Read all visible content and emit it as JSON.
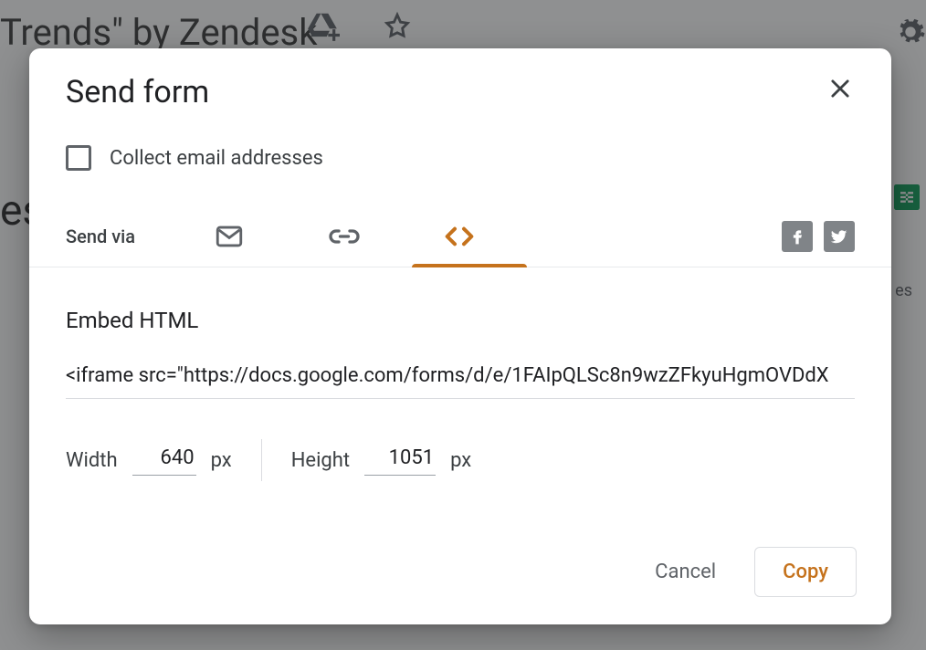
{
  "background": {
    "page_title_fragment": "Trends\" by Zendesk",
    "label_left_fragment": "es",
    "label_right_fragment": "es"
  },
  "dialog": {
    "title": "Send form",
    "collect_label": "Collect email addresses",
    "send_via_label": "Send via",
    "tabs": {
      "email": "email-tab",
      "link": "link-tab",
      "embed": "embed-tab"
    },
    "section_title": "Embed HTML",
    "iframe_value": "<iframe src=\"https://docs.google.com/forms/d/e/1FAIpQLSc8n9wzZFkyuHgmOVDdX",
    "width_label": "Width",
    "width_value": "640",
    "width_unit": "px",
    "height_label": "Height",
    "height_value": "1051",
    "height_unit": "px",
    "cancel_label": "Cancel",
    "copy_label": "Copy"
  },
  "colors": {
    "accent": "#c5721c"
  }
}
